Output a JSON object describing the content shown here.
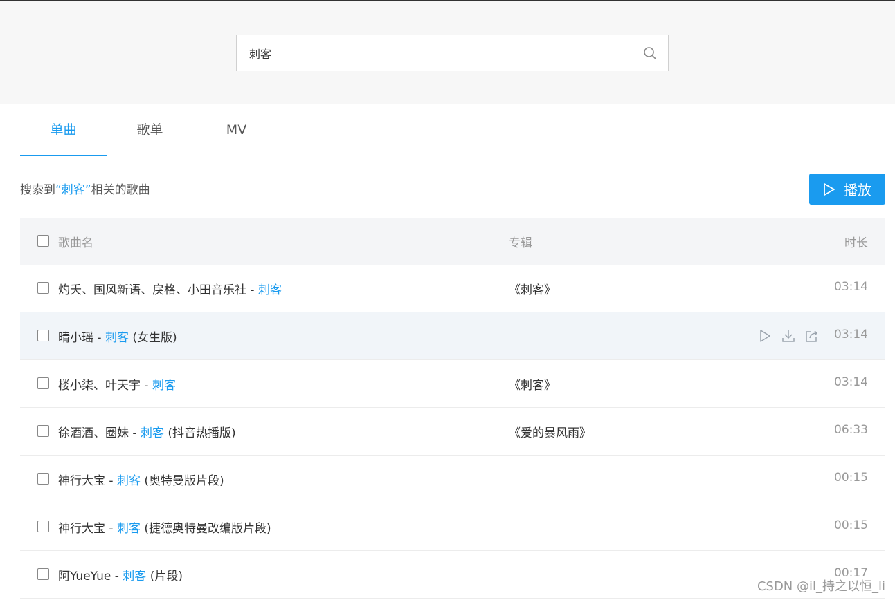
{
  "search": {
    "value": "刺客"
  },
  "tabs": [
    {
      "label": "单曲",
      "active": true
    },
    {
      "label": "歌单",
      "active": false
    },
    {
      "label": "MV",
      "active": false
    }
  ],
  "summary": {
    "prefix": "搜索到",
    "keyword": "“刺客”",
    "suffix": "相关的歌曲"
  },
  "play_all_label": "播放",
  "table": {
    "headers": {
      "name": "歌曲名",
      "album": "专辑",
      "duration": "时长"
    },
    "rows": [
      {
        "artist": "灼夭、国风新语、戾格、小田音乐社",
        "sep": " - ",
        "title": "刺客",
        "extra": "",
        "album": "《刺客》",
        "duration": "03:14"
      },
      {
        "artist": "晴小瑶",
        "sep": " - ",
        "title": "刺客",
        "extra": " (女生版)",
        "album": "",
        "duration": "03:14"
      },
      {
        "artist": "楼小柒、叶天宇",
        "sep": " - ",
        "title": "刺客",
        "extra": "",
        "album": "《刺客》",
        "duration": "03:14"
      },
      {
        "artist": "徐酒酒、圈妹",
        "sep": " - ",
        "title": "刺客",
        "extra": " (抖音热播版)",
        "album": "《爱的暴风雨》",
        "duration": "06:33"
      },
      {
        "artist": "神行大宝",
        "sep": " - ",
        "title": "刺客",
        "extra": " (奥特曼版片段)",
        "album": "",
        "duration": "00:15"
      },
      {
        "artist": "神行大宝",
        "sep": " - ",
        "title": "刺客",
        "extra": " (捷德奥特曼改编版片段)",
        "album": "",
        "duration": "00:15"
      },
      {
        "artist": "阿YueYue",
        "sep": " - ",
        "title": "刺客",
        "extra": " (片段)",
        "album": "",
        "duration": "00:17"
      }
    ]
  },
  "row_actions_icons": [
    "play-icon",
    "download-icon",
    "share-icon"
  ],
  "watermark": "CSDN @il_持之以恒_li",
  "colors": {
    "accent": "#1a9bef",
    "muted": "#999999"
  }
}
